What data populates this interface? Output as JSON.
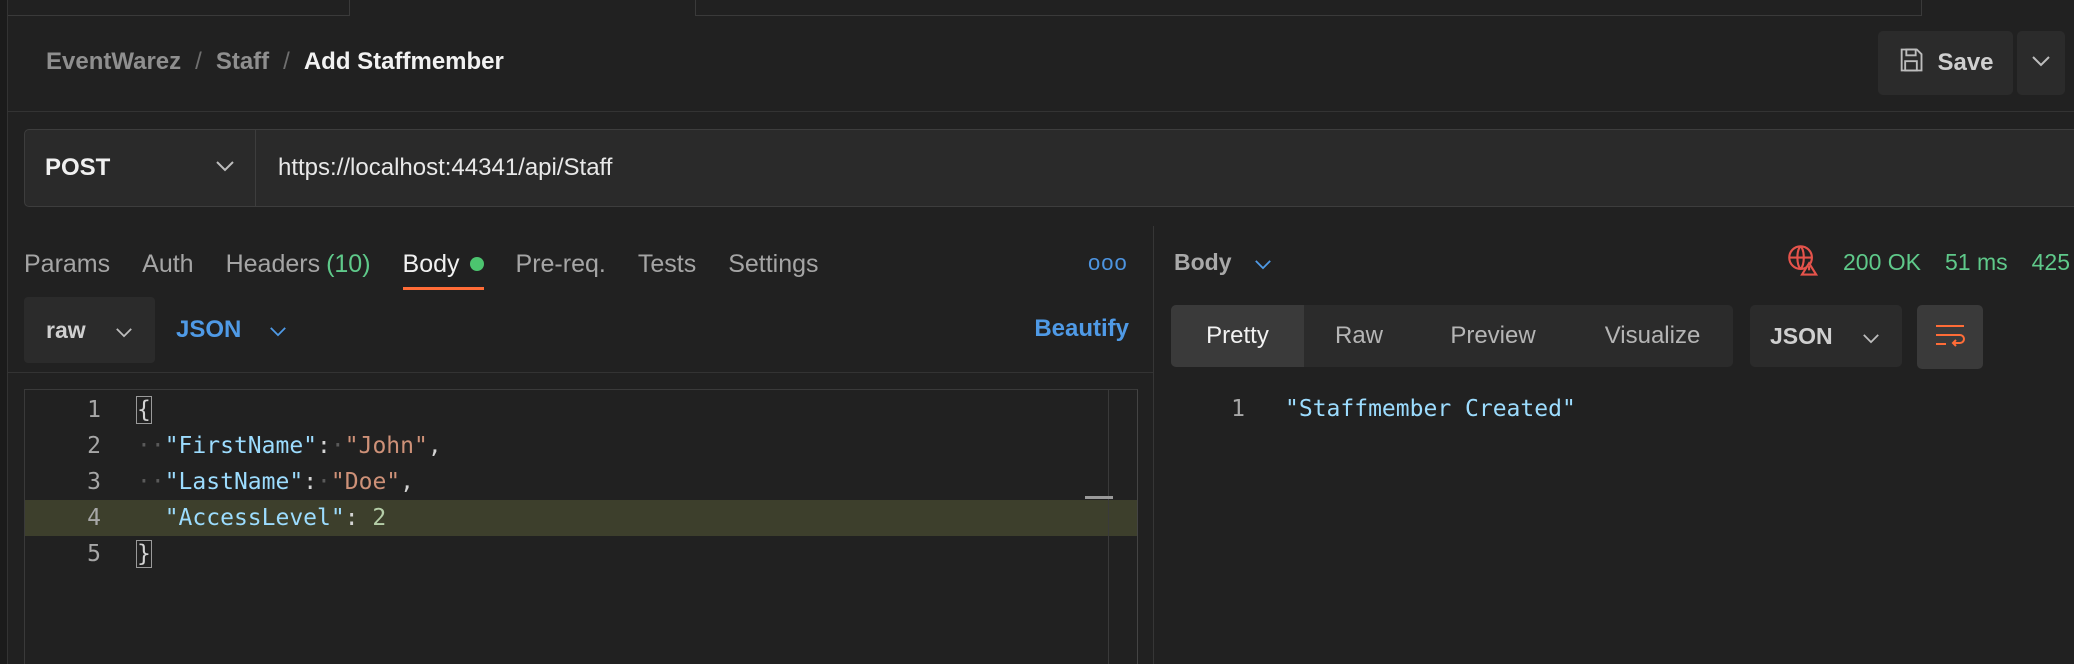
{
  "breadcrumb": {
    "workspace": "EventWarez",
    "folder": "Staff",
    "current": "Add Staffmember",
    "separator": "/"
  },
  "header": {
    "save_label": "Save"
  },
  "request": {
    "method": "POST",
    "url": "https://localhost:44341/api/Staff"
  },
  "request_tabs": [
    {
      "label": "Params"
    },
    {
      "label": "Auth"
    },
    {
      "label": "Headers",
      "count": "(10)"
    },
    {
      "label": "Body",
      "active": true
    },
    {
      "label": "Pre-req."
    },
    {
      "label": "Tests"
    },
    {
      "label": "Settings"
    }
  ],
  "more_label": "ooo",
  "body_toolbar": {
    "mode": "raw",
    "language": "JSON",
    "beautify_label": "Beautify"
  },
  "editor": {
    "line_numbers": [
      "1",
      "2",
      "3",
      "4",
      "5"
    ],
    "lines": [
      {
        "open": "{"
      },
      {
        "key": "\"FirstName\"",
        "value": "\"John\"",
        "trail": ","
      },
      {
        "key": "\"LastName\"",
        "value": "\"Doe\"",
        "trail": ","
      },
      {
        "key": "\"AccessLevel\"",
        "value": "2",
        "trail": ""
      },
      {
        "close": "}"
      }
    ]
  },
  "response": {
    "section_label": "Body",
    "status": "200 OK",
    "time": "51 ms",
    "size": "425",
    "view_tabs": [
      "Pretty",
      "Raw",
      "Preview",
      "Visualize"
    ],
    "active_view": "Pretty",
    "format": "JSON",
    "line_number": "1",
    "content": "\"Staffmember Created\""
  },
  "colors": {
    "accent_orange": "#ff6c37",
    "link_blue": "#4f9ae6",
    "success_green": "#5fc98a",
    "error_red": "#e5534b"
  }
}
